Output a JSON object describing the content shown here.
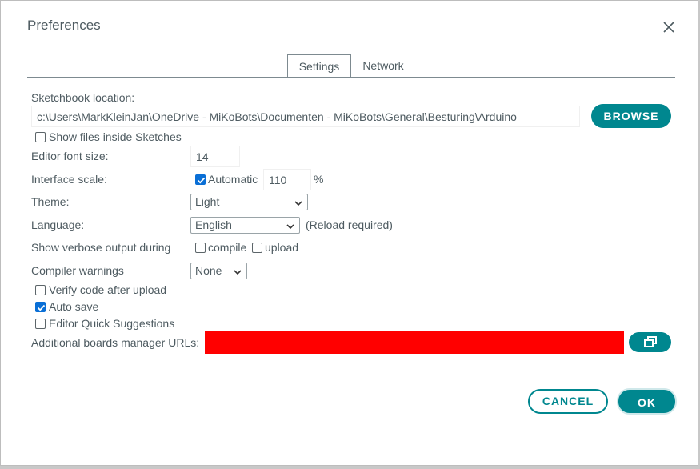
{
  "window": {
    "title": "Preferences"
  },
  "tabs": [
    {
      "label": "Settings",
      "active": true
    },
    {
      "label": "Network",
      "active": false
    }
  ],
  "sketchbook": {
    "label": "Sketchbook location:",
    "value": "c:\\Users\\MarkKleinJan\\OneDrive - MiKoBots\\Documenten - MiKoBots\\General\\Besturing\\Arduino",
    "browse_label": "BROWSE",
    "show_files_label": "Show files inside Sketches",
    "show_files_checked": false
  },
  "editor_font": {
    "label": "Editor font size:",
    "value": "14"
  },
  "interface_scale": {
    "label": "Interface scale:",
    "automatic_label": "Automatic",
    "automatic_checked": true,
    "value": "110",
    "unit": "%"
  },
  "theme": {
    "label": "Theme:",
    "selected": "Light"
  },
  "language": {
    "label": "Language:",
    "selected": "English",
    "note": "(Reload required)"
  },
  "verbose": {
    "label": "Show verbose output during",
    "compile_label": "compile",
    "compile_checked": false,
    "upload_label": "upload",
    "upload_checked": false
  },
  "compiler_warnings": {
    "label": "Compiler warnings",
    "selected": "None"
  },
  "options": [
    {
      "label": "Verify code after upload",
      "checked": false
    },
    {
      "label": "Auto save",
      "checked": true
    },
    {
      "label": "Editor Quick Suggestions",
      "checked": false
    }
  ],
  "boards_urls": {
    "label": "Additional boards manager URLs:",
    "value": "",
    "redacted_color": "#ff0000"
  },
  "footer": {
    "cancel_label": "CANCEL",
    "ok_label": "OK"
  },
  "colors": {
    "accent": "#00878f",
    "checkbox": "#0a6fd6",
    "text": "#4e5b61"
  }
}
